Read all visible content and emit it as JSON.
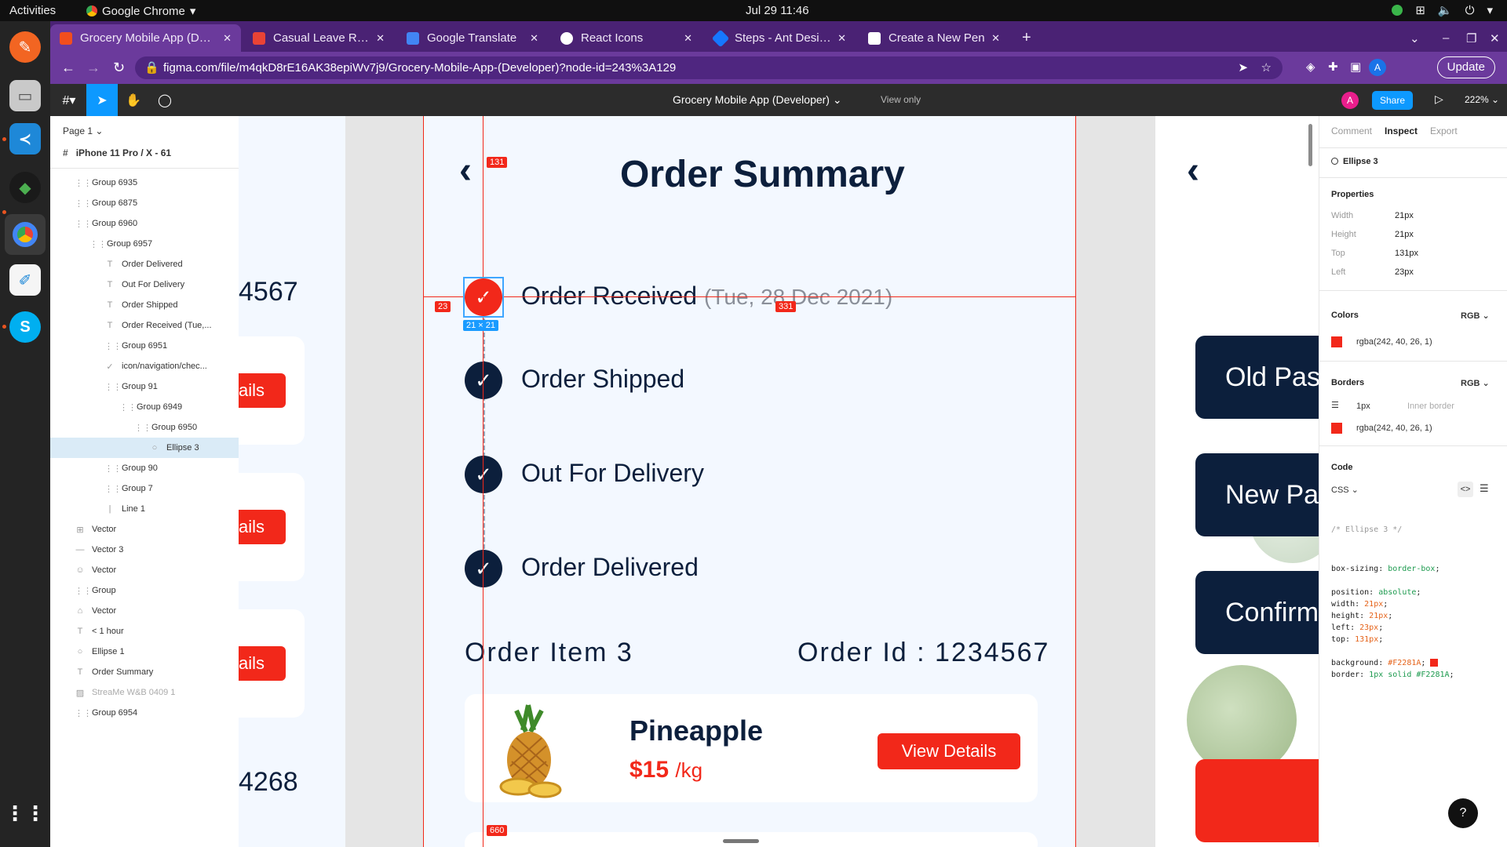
{
  "topbar": {
    "activities": "Activities",
    "app_name": "Google Chrome",
    "clock": "Jul 29  11:46"
  },
  "tabs": [
    {
      "title": "Grocery Mobile App (Deve",
      "color": "#f24e1e"
    },
    {
      "title": "Casual Leave Required - d",
      "color": "#ea4335"
    },
    {
      "title": "Google Translate",
      "color": "#4285f4"
    },
    {
      "title": "React Icons",
      "color": "#ffffff"
    },
    {
      "title": "Steps - Ant Design",
      "color": "#1677ff"
    },
    {
      "title": "Create a New Pen",
      "color": "#ffffff"
    }
  ],
  "address": {
    "url": "figma.com/file/m4qkD8rE16AK38epiWv7j9/Grocery-Mobile-App-(Developer)?node-id=243%3A129",
    "update_label": "Update"
  },
  "figma": {
    "file_title": "Grocery Mobile App (Developer)",
    "view_only": "View only",
    "share": "Share",
    "zoom": "222%",
    "avatar": "A"
  },
  "layers": {
    "page": "Page 1",
    "frame": "iPhone 11 Pro / X - 61",
    "items": [
      {
        "name": "Group 6935",
        "icon": "group-icon",
        "indent": 1
      },
      {
        "name": "Group 6875",
        "icon": "group-icon",
        "indent": 1
      },
      {
        "name": "Group 6960",
        "icon": "group-icon",
        "indent": 1
      },
      {
        "name": "Group 6957",
        "icon": "group-icon",
        "indent": 2
      },
      {
        "name": "Order Delivered",
        "icon": "text-icon",
        "indent": 3
      },
      {
        "name": "Out For Delivery",
        "icon": "text-icon",
        "indent": 3
      },
      {
        "name": "Order Shipped",
        "icon": "text-icon",
        "indent": 3
      },
      {
        "name": "Order Received (Tue,...",
        "icon": "text-icon",
        "indent": 3
      },
      {
        "name": "Group 6951",
        "icon": "group-icon",
        "indent": 3
      },
      {
        "name": "icon/navigation/chec...",
        "icon": "check-icon",
        "indent": 3
      },
      {
        "name": "Group 91",
        "icon": "group-icon",
        "indent": 3
      },
      {
        "name": "Group 6949",
        "icon": "group-icon",
        "indent": 4
      },
      {
        "name": "Group 6950",
        "icon": "group-icon",
        "indent": 5
      },
      {
        "name": "Ellipse 3",
        "icon": "ellipse-icon",
        "indent": 6,
        "selected": true
      },
      {
        "name": "Group 90",
        "icon": "group-icon",
        "indent": 3
      },
      {
        "name": "Group 7",
        "icon": "group-icon",
        "indent": 3
      },
      {
        "name": "Line 1",
        "icon": "line-icon",
        "indent": 3
      },
      {
        "name": "Vector",
        "icon": "component-icon",
        "indent": 1
      },
      {
        "name": "Vector 3",
        "icon": "vector-icon",
        "indent": 1
      },
      {
        "name": "Vector",
        "icon": "person-icon",
        "indent": 1
      },
      {
        "name": "Group",
        "icon": "group-icon",
        "indent": 1
      },
      {
        "name": "Vector",
        "icon": "home-icon",
        "indent": 1
      },
      {
        "name": "< 1 hour",
        "icon": "text-icon",
        "indent": 1
      },
      {
        "name": "Ellipse 1",
        "icon": "ellipse-icon",
        "indent": 1
      },
      {
        "name": "Order Summary",
        "icon": "text-icon",
        "indent": 1
      },
      {
        "name": "StreaMe W&B 0409 1",
        "icon": "image-icon",
        "indent": 1,
        "dim": true
      },
      {
        "name": "Group 6954",
        "icon": "group-icon",
        "indent": 1
      }
    ]
  },
  "canvas": {
    "left_ids": [
      "4567",
      "4268"
    ],
    "left_btn": "ails",
    "title": "Order Summary",
    "steps": [
      {
        "label": "Order Received",
        "date": "(Tue, 28 Dec 2021)"
      },
      {
        "label": "Order Shipped"
      },
      {
        "label": "Out For Delivery"
      },
      {
        "label": "Order Delivered"
      }
    ],
    "order_item": "Order Item 3",
    "order_id": "Order Id : 1234567",
    "product": {
      "name": "Pineapple",
      "price": "$15",
      "unit": "/kg",
      "button": "View Details"
    },
    "right_buttons": [
      "Old Pas",
      "New Pas",
      "Confirm"
    ],
    "measures": {
      "top": "131",
      "left": "23",
      "right": "331",
      "bottom": "660",
      "size": "21 × 21"
    },
    "accent": "#F2281A",
    "navy": "#0c1f3c"
  },
  "inspect": {
    "tabs": [
      "Comment",
      "Inspect",
      "Export"
    ],
    "layer": "Ellipse 3",
    "properties_title": "Properties",
    "props": [
      {
        "label": "Width",
        "value": "21px"
      },
      {
        "label": "Height",
        "value": "21px"
      },
      {
        "label": "Top",
        "value": "131px"
      },
      {
        "label": "Left",
        "value": "23px"
      }
    ],
    "colors_title": "Colors",
    "color_mode": "RGB",
    "color": "rgba(242, 40, 26, 1)",
    "borders_title": "Borders",
    "border_mode": "RGB",
    "border_width": "1px",
    "border_kind": "Inner border",
    "border_color": "rgba(242, 40, 26, 1)",
    "code_title": "Code",
    "code_lang": "CSS",
    "code_comment": "/* Ellipse 3 */",
    "code_lines": [
      {
        "p": "box-sizing: ",
        "v": "border-box",
        "k": "g"
      },
      {
        "p": "position: ",
        "v": "absolute",
        "k": "g"
      },
      {
        "p": "width: ",
        "v": "21px",
        "k": "v"
      },
      {
        "p": "height: ",
        "v": "21px",
        "k": "v"
      },
      {
        "p": "left: ",
        "v": "23px",
        "k": "v"
      },
      {
        "p": "top: ",
        "v": "131px",
        "k": "v"
      },
      {
        "p": "background: ",
        "v": "#F2281A",
        "k": "v"
      },
      {
        "p": "border: ",
        "v": "1px solid #F2281A",
        "k": "g"
      }
    ],
    "help": "?"
  }
}
